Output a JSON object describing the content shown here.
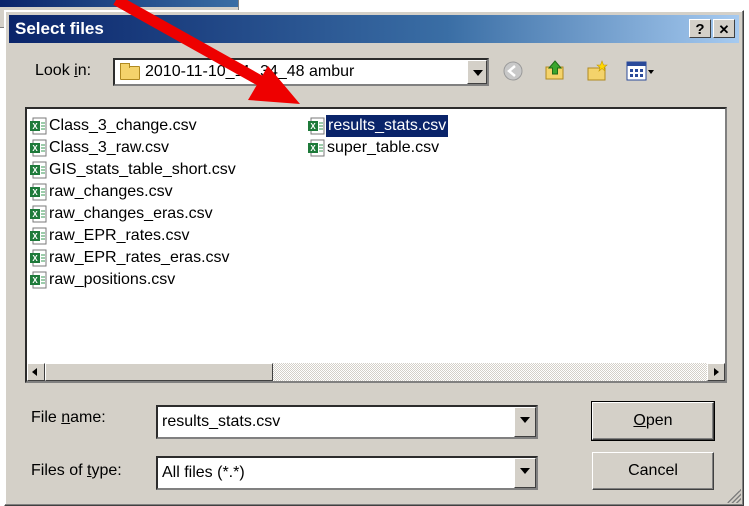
{
  "dialog": {
    "title": "Select files",
    "help_button": "?",
    "close_button": "✕"
  },
  "lookin": {
    "label_pre": "Look ",
    "label_accel": "i",
    "label_post": "n:",
    "folder": "2010-11-10_11_34_48 ambur"
  },
  "toolbar": {
    "back": "back-icon",
    "up": "up-folder-icon",
    "newfolder": "new-folder-icon",
    "views": "views-menu-icon"
  },
  "files": {
    "col1": [
      "Class_3_change.csv",
      "Class_3_raw.csv",
      "GIS_stats_table_short.csv",
      "raw_changes.csv",
      "raw_changes_eras.csv",
      "raw_EPR_rates.csv",
      "raw_EPR_rates_eras.csv",
      "raw_positions.csv"
    ],
    "col2": [
      "results_stats.csv",
      "super_table.csv"
    ],
    "selected": "results_stats.csv"
  },
  "filename": {
    "label_pre": "File ",
    "label_accel": "n",
    "label_post": "ame:",
    "value": "results_stats.csv"
  },
  "filetype": {
    "label_pre": "Files of ",
    "label_accel": "t",
    "label_post": "ype:",
    "value": "All files (*.*)"
  },
  "buttons": {
    "open_accel": "O",
    "open_rest": "pen",
    "cancel": "Cancel"
  },
  "colors": {
    "arrow": "#ee0000",
    "titlebar": "#0a246a",
    "selection": "#0a246a"
  }
}
